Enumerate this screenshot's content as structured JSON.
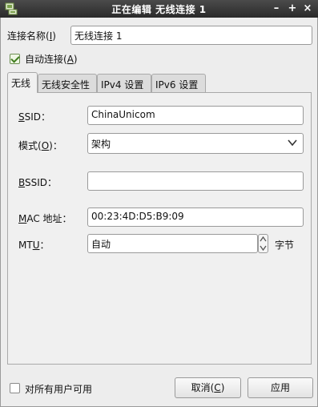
{
  "window": {
    "title": "正在编辑 无线连接 1",
    "controls": {
      "minimize": "–",
      "maximize": "+",
      "close": "×"
    }
  },
  "connection": {
    "name_label": "连接名称(",
    "name_mnemonic": "I",
    "name_label_end": ")",
    "name_value": "无线连接 1",
    "autoconnect_label": "自动连接(",
    "autoconnect_mnemonic": "A",
    "autoconnect_label_end": ")",
    "autoconnect_checked": true
  },
  "tabs": [
    {
      "label": "无线"
    },
    {
      "label": "无线安全性"
    },
    {
      "label": "IPv4 设置"
    },
    {
      "label": "IPv6 设置"
    }
  ],
  "wireless": {
    "ssid": {
      "mnemonic": "S",
      "label_rest": "SID：",
      "value": "ChinaUnicom"
    },
    "mode": {
      "label": "模式(",
      "mnemonic": "O",
      "label_end": ")：",
      "value": "架构"
    },
    "bssid": {
      "mnemonic": "B",
      "label_rest": "SSID：",
      "value": ""
    },
    "mac": {
      "mnemonic": "M",
      "label_rest": "AC 地址：",
      "value": "00:23:4D:D5:B9:09"
    },
    "mtu": {
      "label_start": "MT",
      "mnemonic": "U",
      "label_rest": "：",
      "value": "自动",
      "unit": "字节"
    }
  },
  "footer": {
    "all_users_label": "对所有用户可用",
    "all_users_checked": false,
    "cancel_label": "取消(",
    "cancel_mnemonic": "C",
    "cancel_label_end": ")",
    "apply_label": "应用"
  }
}
